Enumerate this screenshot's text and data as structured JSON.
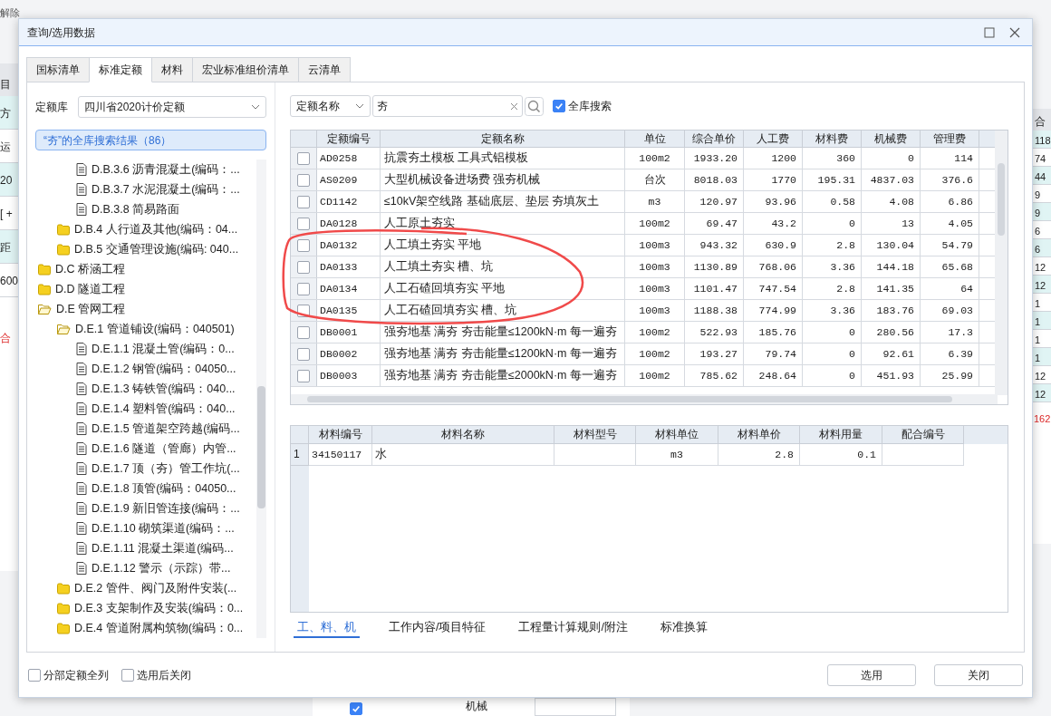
{
  "background": {
    "toolbar_text": "解除",
    "left_header": "目",
    "left_column": [
      "方",
      "运",
      "20",
      "[ +",
      "距",
      "600"
    ],
    "left_total": "合",
    "right_header": "合",
    "right_column": [
      "118",
      "74",
      "44",
      "9",
      "9",
      "6",
      "6",
      "12",
      "12",
      "1",
      "1",
      "1",
      "1",
      "12",
      "12"
    ],
    "right_total": "162",
    "bottom_checkbox": {
      "checked": true
    },
    "bottom_label": "机械"
  },
  "dialog": {
    "title": "查询/选用数据"
  },
  "tabs": [
    {
      "label": "国标清单",
      "selected": false
    },
    {
      "label": "标准定额",
      "selected": true
    },
    {
      "label": "材料",
      "selected": false
    },
    {
      "label": "宏业标准组价清单",
      "selected": false
    },
    {
      "label": "云清单",
      "selected": false
    }
  ],
  "library": {
    "label": "定额库",
    "value": "四川省2020计价定额"
  },
  "search_result": "“夯”的全库搜索结果（86）",
  "tree": [
    {
      "children": [
        {
          "children": [
            {
              "label": "D.B.3.6 沥青混凝土(编码：...",
              "kind": "file"
            },
            {
              "label": "D.B.3.7 水泥混凝土(编码：...",
              "kind": "file"
            },
            {
              "label": "D.B.3.8 简易路面",
              "kind": "file"
            }
          ]
        },
        {
          "label": "D.B.4 人行道及其他(编码：04...",
          "kind": "folder",
          "expanded": false
        },
        {
          "label": "D.B.5 交通管理设施(编码: 040...",
          "kind": "folder",
          "expanded": false
        }
      ]
    },
    {
      "label": "D.C 桥涵工程",
      "kind": "folder",
      "expanded": false
    },
    {
      "label": "D.D 隧道工程",
      "kind": "folder",
      "expanded": false
    },
    {
      "label": "D.E 管网工程",
      "kind": "folder",
      "expanded": true,
      "children": [
        {
          "label": "D.E.1 管道铺设(编码：040501)",
          "kind": "folder",
          "expanded": true,
          "children": [
            {
              "label": "D.E.1.1 混凝土管(编码：0...",
              "kind": "file"
            },
            {
              "label": "D.E.1.2 钢管(编码：04050...",
              "kind": "file"
            },
            {
              "label": "D.E.1.3 铸铁管(编码：040...",
              "kind": "file"
            },
            {
              "label": "D.E.1.4 塑料管(编码：040...",
              "kind": "file"
            },
            {
              "label": "D.E.1.5 管道架空跨越(编码...",
              "kind": "file"
            },
            {
              "label": "D.E.1.6 隧道（管廊）内管...",
              "kind": "file"
            },
            {
              "label": "D.E.1.7 顶（夯）管工作坑(...",
              "kind": "file"
            },
            {
              "label": "D.E.1.8 顶管(编码：04050...",
              "kind": "file"
            },
            {
              "label": "D.E.1.9 新旧管连接(编码：...",
              "kind": "file"
            },
            {
              "label": "D.E.1.10 砌筑渠道(编码：...",
              "kind": "file"
            },
            {
              "label": "D.E.1.11 混凝土渠道(编码...",
              "kind": "file"
            },
            {
              "label": "D.E.1.12 警示（示踪）带...",
              "kind": "file"
            }
          ]
        },
        {
          "label": "D.E.2 管件、阀门及附件安装(...",
          "kind": "folder",
          "expanded": false
        },
        {
          "label": "D.E.3 支架制作及安装(编码：0...",
          "kind": "folder",
          "expanded": false
        },
        {
          "label": "D.E.4 管道附属构筑物(编码：0...",
          "kind": "folder",
          "expanded": false
        }
      ]
    }
  ],
  "search": {
    "field": "定额名称",
    "value": "夯",
    "all_library": {
      "label": "全库搜索",
      "checked": true
    }
  },
  "quota_table": {
    "columns": [
      "定额编号",
      "定额名称",
      "单位",
      "综合单价",
      "人工费",
      "材料费",
      "机械费",
      "管理费"
    ],
    "rows": [
      {
        "checked": false,
        "cells": [
          "AD0258",
          "抗震夯土模板 工具式铝模板",
          "100m2",
          "1933.20",
          "1200",
          "360",
          "0",
          "114"
        ]
      },
      {
        "checked": false,
        "cells": [
          "AS0209",
          "大型机械设备进场费 强夯机械",
          "台次",
          "8018.03",
          "1770",
          "195.31",
          "4837.03",
          "376.6"
        ]
      },
      {
        "checked": false,
        "cells": [
          "CD1142",
          "≤10kV架空线路 基础底层、垫层 夯填灰土",
          "m3",
          "120.97",
          "93.96",
          "0.58",
          "4.08",
          "6.86"
        ]
      },
      {
        "checked": false,
        "cells": [
          "DA0128",
          "人工原土夯实",
          "100m2",
          "69.47",
          "43.2",
          "0",
          "13",
          "4.05"
        ]
      },
      {
        "checked": false,
        "cells": [
          "DA0132",
          "人工填土夯实 平地",
          "100m3",
          "943.32",
          "630.9",
          "2.8",
          "130.04",
          "54.79"
        ]
      },
      {
        "checked": false,
        "cells": [
          "DA0133",
          "人工填土夯实 槽、坑",
          "100m3",
          "1130.89",
          "768.06",
          "3.36",
          "144.18",
          "65.68"
        ]
      },
      {
        "checked": false,
        "cells": [
          "DA0134",
          "人工石碴回填夯实 平地",
          "100m3",
          "1101.47",
          "747.54",
          "2.8",
          "141.35",
          "64"
        ]
      },
      {
        "checked": false,
        "cells": [
          "DA0135",
          "人工石碴回填夯实 槽、坑",
          "100m3",
          "1188.38",
          "774.99",
          "3.36",
          "183.76",
          "69.03"
        ]
      },
      {
        "checked": false,
        "cells": [
          "DB0001",
          "强夯地基 满夯 夯击能量≤1200kN·m 每一遍夯",
          "100m2",
          "522.93",
          "185.76",
          "0",
          "280.56",
          "17.3"
        ]
      },
      {
        "checked": false,
        "cells": [
          "DB0002",
          "强夯地基 满夯 夯击能量≤1200kN·m 每一遍夯",
          "100m2",
          "193.27",
          "79.74",
          "0",
          "92.61",
          "6.39"
        ]
      },
      {
        "checked": false,
        "cells": [
          "DB0003",
          "强夯地基 满夯 夯击能量≤2000kN·m 每一遍夯",
          "100m2",
          "785.62",
          "248.64",
          "0",
          "451.93",
          "25.99"
        ]
      }
    ]
  },
  "material_table": {
    "columns": [
      "材料编号",
      "材料名称",
      "材料型号",
      "材料单位",
      "材料单价",
      "材料用量",
      "配合编号"
    ],
    "rows": [
      {
        "index": "1",
        "cells": [
          "34150117",
          "水",
          "",
          "m3",
          "2.8",
          "0.1",
          ""
        ]
      }
    ]
  },
  "detail_tabs": [
    {
      "label": "工、料、机",
      "selected": true
    },
    {
      "label": "工作内容/项目特征",
      "selected": false
    },
    {
      "label": "工程量计算规则/附注",
      "selected": false
    },
    {
      "label": "标准换算",
      "selected": false
    }
  ],
  "options": [
    {
      "label": "分部定额全列",
      "checked": false
    },
    {
      "label": "选用后关闭",
      "checked": false
    }
  ],
  "buttons": [
    "选用",
    "关闭"
  ]
}
